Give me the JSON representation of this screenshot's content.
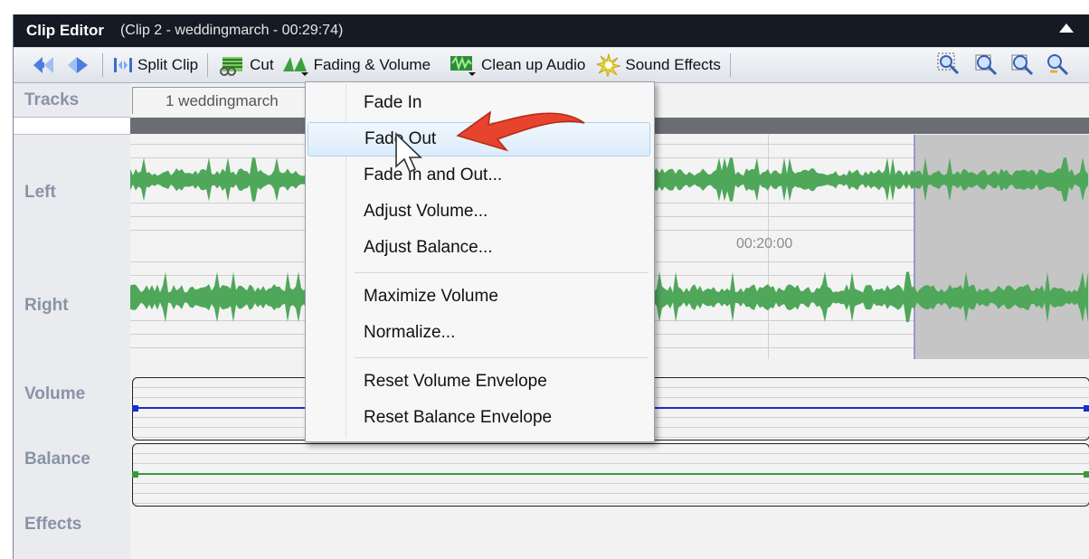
{
  "window": {
    "title": "Clip Editor",
    "subtitle": "(Clip 2 - weddingmarch - 00:29:74)"
  },
  "toolbar": {
    "split_clip": "Split Clip",
    "cut": "Cut",
    "fading_volume": "Fading & Volume",
    "clean_up_audio": "Clean up Audio",
    "sound_effects": "Sound Effects"
  },
  "tracks": {
    "header": "Tracks",
    "tab": "1 weddingmarch",
    "labels": {
      "left": "Left",
      "right": "Right",
      "volume": "Volume",
      "balance": "Balance",
      "effects": "Effects"
    },
    "timecode": "00:20:00"
  },
  "menu": {
    "items": [
      {
        "label": "Fade In"
      },
      {
        "label": "Fade Out"
      },
      {
        "label": "Fade In and Out..."
      },
      {
        "label": "Adjust Volume..."
      },
      {
        "label": "Adjust Balance..."
      },
      {
        "label": "Maximize Volume"
      },
      {
        "label": "Normalize..."
      },
      {
        "label": "Reset Volume Envelope"
      },
      {
        "label": "Reset Balance Envelope"
      }
    ],
    "highlighted_index": 1
  },
  "colors": {
    "waveform": "#4fa75a",
    "volume_line": "#1b2fcc",
    "balance_line": "#3a9a3a",
    "arrow": "#e8432c",
    "title_bar": "#151a24"
  }
}
